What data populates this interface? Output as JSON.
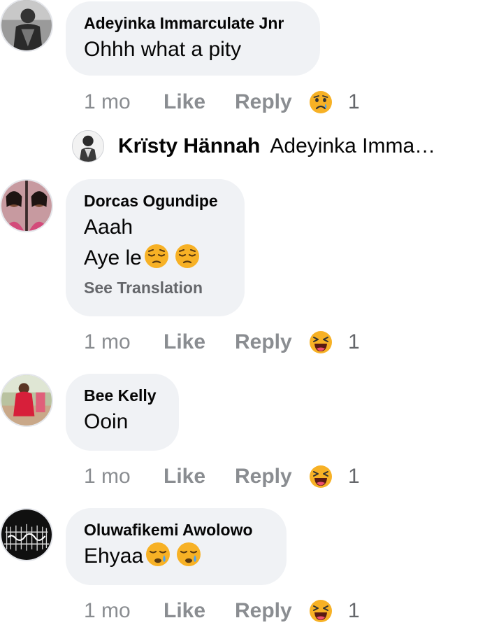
{
  "comments": [
    {
      "author": "Adeyinka Immarculate Jnr",
      "lines": [
        "Ohhh what a pity"
      ],
      "time": "1 mo",
      "like": "Like",
      "reply": "Reply",
      "reaction_icon": "sad-reaction-icon",
      "reaction_count": "1",
      "reply_preview": {
        "author": "Krïsty Hännah",
        "text": "Adeyinka Imma…"
      }
    },
    {
      "author": "Dorcas Ogundipe",
      "lines": [
        "Aaah",
        "Aye le"
      ],
      "line2_emojis": [
        "pensive-face-emoji",
        "pensive-face-emoji"
      ],
      "see_translation": "See Translation",
      "time": "1 mo",
      "like": "Like",
      "reply": "Reply",
      "reaction_icon": "haha-reaction-icon",
      "reaction_count": "1"
    },
    {
      "author": "Bee Kelly",
      "lines": [
        "Ooin"
      ],
      "time": "1 mo",
      "like": "Like",
      "reply": "Reply",
      "reaction_icon": "haha-reaction-icon",
      "reaction_count": "1"
    },
    {
      "author": "Oluwafikemi Awolowo",
      "lines": [
        "Ehyaa"
      ],
      "line1_emojis": [
        "sleepy-face-emoji",
        "sleepy-face-emoji"
      ],
      "time": "1 mo",
      "like": "Like",
      "reply": "Reply",
      "reaction_icon": "haha-reaction-icon",
      "reaction_count": "1"
    }
  ],
  "colors": {
    "bubble": "#f0f2f5",
    "meta_text": "#8a8d91",
    "primary_text": "#050505",
    "emoji_yellow": "#f7b125"
  }
}
